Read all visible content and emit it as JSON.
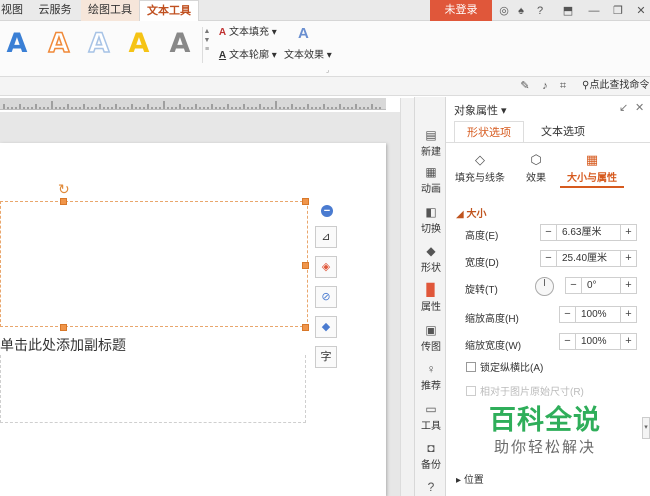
{
  "menubar": {
    "tabs": [
      {
        "label": "视图",
        "state": "normal"
      },
      {
        "label": "云服务",
        "state": "normal"
      },
      {
        "label": "绘图工具",
        "state": "tool"
      },
      {
        "label": "文本工具",
        "state": "active"
      }
    ],
    "login_label": "未登录",
    "icons": [
      "skin-icon",
      "shirt-icon",
      "help-icon",
      "collapse-ribbon-icon",
      "minimize-icon",
      "maximize-icon",
      "close-icon"
    ]
  },
  "ribbon": {
    "wordart_styles": [
      {
        "glyph": "A",
        "color": "#3a7fd5"
      },
      {
        "glyph": "A",
        "color": "#f08a3a"
      },
      {
        "glyph": "A",
        "color": "#a7c3e6"
      },
      {
        "glyph": "A",
        "color": "#f5c315"
      },
      {
        "glyph": "A",
        "color": "#888888"
      }
    ],
    "text_fill_label": "文本填充",
    "text_outline_label": "文本轮廓",
    "text_effect_label": "文本效果"
  },
  "subbar": {
    "find_label": "点此查找命令"
  },
  "canvas": {
    "subtitle_placeholder": "单击此处添加副标题"
  },
  "rail": {
    "items": [
      {
        "label": "新建",
        "icon": "new-icon"
      },
      {
        "label": "动画",
        "icon": "animation-icon"
      },
      {
        "label": "切换",
        "icon": "transition-icon"
      },
      {
        "label": "形状",
        "icon": "shape-icon"
      },
      {
        "label": "属性",
        "icon": "properties-icon",
        "active": true
      },
      {
        "label": "传图",
        "icon": "upload-image-icon"
      },
      {
        "label": "推荐",
        "icon": "recommend-icon"
      },
      {
        "label": "工具",
        "icon": "toolbox-icon"
      },
      {
        "label": "备份",
        "icon": "backup-icon"
      }
    ]
  },
  "panel": {
    "title": "对象属性",
    "tabs": [
      "形状选项",
      "文本选项"
    ],
    "subtabs": [
      "填充与线条",
      "效果",
      "大小与属性"
    ],
    "section": "大小",
    "height_label": "高度(E)",
    "height_value": "6.63厘米",
    "width_label": "宽度(D)",
    "width_value": "25.40厘米",
    "rotation_label": "旋转(T)",
    "rotation_value": "0°",
    "scale_h_label": "缩放高度(H)",
    "scale_h_value": "100%",
    "scale_w_label": "缩放宽度(W)",
    "scale_w_value": "100%",
    "lock_ratio_label": "锁定纵横比(A)",
    "relative_label": "相对于图片原始尺寸(R)",
    "position_label": "位置"
  },
  "watermark": {
    "title": "百科全说",
    "subtitle": "助你轻松解决"
  }
}
